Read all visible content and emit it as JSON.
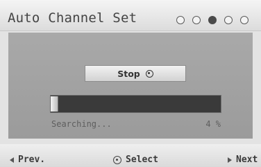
{
  "header": {
    "title": "Auto Channel Set",
    "steps": {
      "total": 5,
      "active_index": 2
    }
  },
  "main": {
    "stop_button": {
      "label": "Stop",
      "icon": "ok-icon"
    },
    "progress": {
      "percent": 4,
      "status_text": "Searching...",
      "percent_text": "4 %"
    }
  },
  "footer": {
    "prev": {
      "label": "Prev.",
      "icon": "arrow-left-icon"
    },
    "select": {
      "label": "Select",
      "icon": "ok-icon"
    },
    "next": {
      "label": "Next",
      "icon": "arrow-right-icon"
    }
  },
  "colors": {
    "background": "#e3e3e3",
    "panel": "#a3a3a3",
    "progress_track": "#3a3a3a",
    "step_active": "#4a4a4a"
  }
}
